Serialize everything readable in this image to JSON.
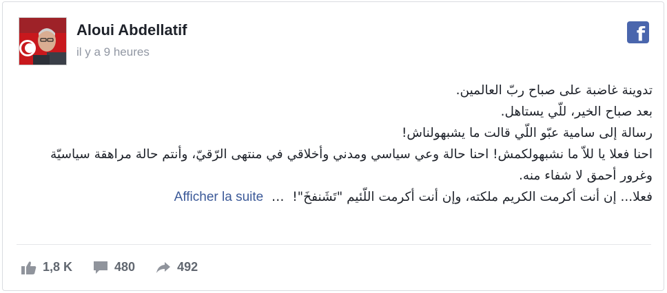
{
  "post": {
    "author": "Aloui Abdellatif",
    "timestamp": "il y a 9 heures",
    "source_icon": "facebook-icon",
    "lines": [
      "تدوينة غاضبة على صباح ربّ العالمين.",
      "بعد صباح الخير، للّي يستاهل.",
      "رسالة إلى سامية عبّو اللّي قالت ما يشبهولناش!",
      "احنا فعلا يا للاّ ما نشبهولكمش! احنا حالة وعي سياسي ومدني وأخلاقي في منتهى الرّقيّ، وأنتم حالة مراهقة سياسيّة وغرور أحمق لا شفاء منه."
    ],
    "last_line": "فعلا... إن أنت أكرمت الكريم ملكته، وإن أنت أكرمت اللّئيم \"تَشَنفخَ\"!",
    "ellipsis": "…",
    "see_more": "Afficher la suite"
  },
  "stats": {
    "likes": "1,8 K",
    "comments": "480",
    "shares": "492"
  },
  "colors": {
    "facebook_blue": "#4a66ad",
    "link": "#3b5998",
    "muted": "#9197a3"
  }
}
